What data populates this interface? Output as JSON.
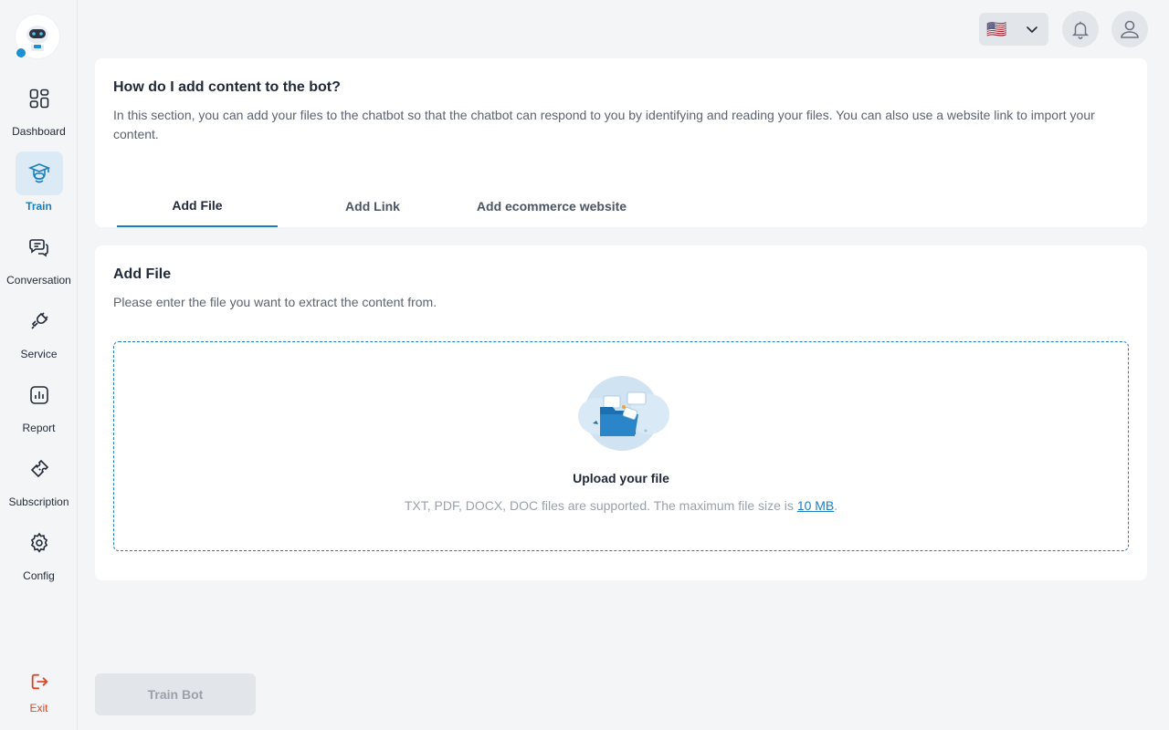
{
  "sidebar": {
    "items": [
      {
        "label": "Dashboard",
        "icon": "dashboard-grid-icon"
      },
      {
        "label": "Train",
        "icon": "train-bot-icon",
        "active": true
      },
      {
        "label": "Conversation",
        "icon": "chat-bubbles-icon"
      },
      {
        "label": "Service",
        "icon": "plug-icon"
      },
      {
        "label": "Report",
        "icon": "bar-chart-icon"
      },
      {
        "label": "Subscription",
        "icon": "ticket-icon"
      },
      {
        "label": "Config",
        "icon": "gear-icon"
      }
    ],
    "exit": {
      "label": "Exit",
      "icon": "logout-icon"
    }
  },
  "header": {
    "language_flag": "🇺🇸",
    "icons": [
      "chevron-down-icon",
      "bell-icon",
      "user-icon"
    ]
  },
  "intro": {
    "title": "How do I add content to the bot?",
    "description": "In this section, you can add your files to the chatbot so that the chatbot can respond to you by identifying and reading your files. You can also use a website link to import your content."
  },
  "tabs": [
    {
      "label": "Add File",
      "active": true
    },
    {
      "label": "Add Link",
      "active": false
    },
    {
      "label": "Add ecommerce website",
      "active": false
    }
  ],
  "add_file": {
    "title": "Add File",
    "description": "Please enter the file you want to extract the content from.",
    "upload_title": "Upload your file",
    "upload_note_prefix": "TXT, PDF, DOCX, DOC files are supported. The maximum file size is ",
    "max_size": "10 MB",
    "upload_note_suffix": "."
  },
  "footer": {
    "train_button": "Train Bot"
  },
  "colors": {
    "accent": "#1b7fbf",
    "active_nav_bg": "#dbeaf4",
    "exit": "#e0452a",
    "disabled_text": "#9aa1ab"
  }
}
